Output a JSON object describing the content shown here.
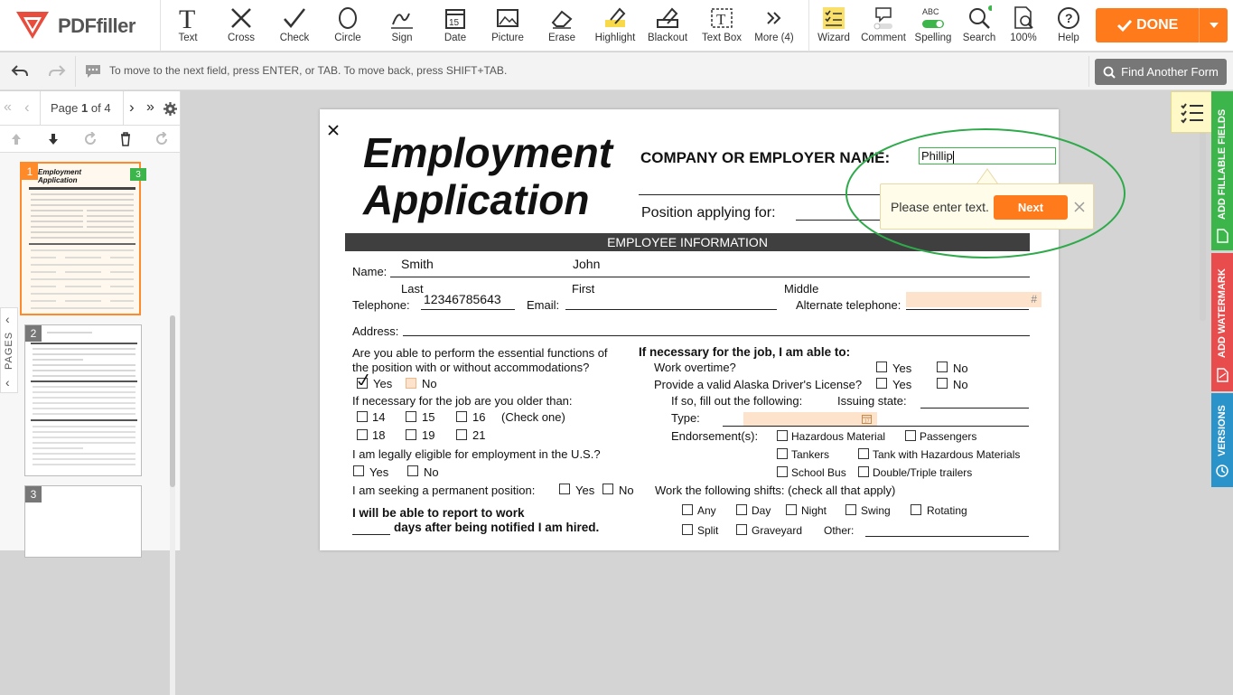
{
  "toolbar": {
    "logo_text": "PDFfiller",
    "tools": [
      "Text",
      "Cross",
      "Check",
      "Circle",
      "Sign",
      "Date",
      "Picture",
      "Erase",
      "Highlight",
      "Blackout",
      "Text Box",
      "More (4)"
    ],
    "right_tools": [
      "Wizard",
      "Comment",
      "Spelling",
      "Search",
      "100%",
      "Help"
    ],
    "spelling_badge": "ABC",
    "done_label": "DONE"
  },
  "bar2": {
    "hint": "To move to the next field, press ENTER, or TAB. To move back, press SHIFT+TAB.",
    "find_form": "Find Another Form"
  },
  "pager": {
    "prefix": "Page",
    "current": "1",
    "suffix": "of 4"
  },
  "sidebar": {
    "pages_label": "PAGES",
    "thumb_numbers": [
      "1",
      "2",
      "3"
    ],
    "badge": "3"
  },
  "side_tabs": {
    "fillable": "ADD FILLABLE FIELDS",
    "watermark": "ADD WATERMARK",
    "versions": "VERSIONS"
  },
  "tooltip": {
    "text": "Please enter text.",
    "next": "Next"
  },
  "colors": {
    "accent": "#ff7a1a",
    "green": "#2faa4a",
    "red": "#e84c4c",
    "blue": "#2a93c9"
  },
  "form": {
    "title1": "Employment",
    "title2": "Application",
    "company_label": "COMPANY OR EMPLOYER NAME:",
    "company_value": "Phillip",
    "position_label": "Position applying for:",
    "section": "EMPLOYEE INFORMATION",
    "name_label": "Name:",
    "last_value": "Smith",
    "first_value": "John",
    "last_label": "Last",
    "first_label": "First",
    "middle_label": "Middle",
    "phone_label": "Telephone:",
    "phone_value": "12346785643",
    "email_label": "Email:",
    "alt_phone_label": "Alternate telephone:",
    "hash": "#",
    "address_label": "Address:",
    "q_essential1": "Are you able to perform the essential functions of",
    "q_essential2": "the position with or without accommodations?",
    "yes": "Yes",
    "no": "No",
    "q_older": "If necessary for the job are you older than:",
    "ages": [
      "14",
      "15",
      "16",
      "18",
      "19",
      "21"
    ],
    "check_one": "(Check one)",
    "q_eligible": "I am legally eligible for employment in the U.S.?",
    "q_permanent": "I am seeking a permanent position:",
    "report1": "I will be able to report to work",
    "report2": "days after being notified I am hired.",
    "if_necessary": "If necessary for the job, I am able to:",
    "overtime": "Work overtime?",
    "license": "Provide a valid Alaska Driver's License?",
    "fill_following": "If so, fill out the following:",
    "issuing": "Issuing state:",
    "type": "Type:",
    "endorse": "Endorsement(s):",
    "endorsements": [
      "Hazardous Material",
      "Passengers",
      "Tankers",
      "Tank with Hazardous Materials",
      "School Bus",
      "Double/Triple trailers"
    ],
    "shifts_label": "Work the following shifts: (check all that apply)",
    "shifts": [
      "Any",
      "Day",
      "Night",
      "Swing",
      "Rotating",
      "Split",
      "Graveyard"
    ],
    "other": "Other:"
  }
}
